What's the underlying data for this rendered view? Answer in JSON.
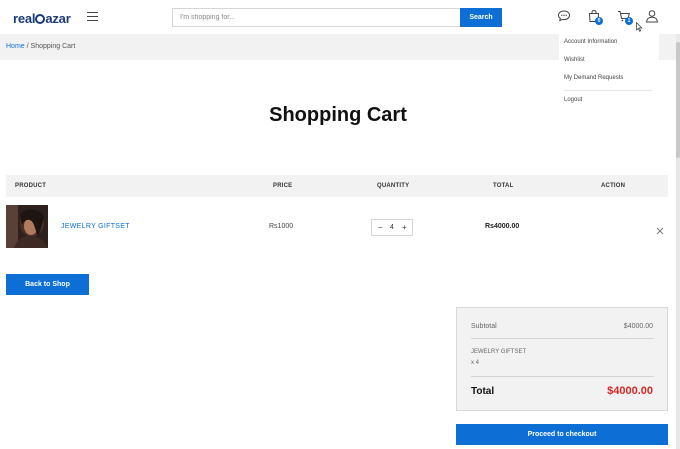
{
  "brand": {
    "name_start": "real",
    "name_end": "azar",
    "accent_color": "#0d6fd6",
    "logo_color": "#1a3a78"
  },
  "search": {
    "placeholder": "I'm shopping for...",
    "button_label": "Search"
  },
  "header": {
    "icons": [
      "menu-icon",
      "chat-icon",
      "bag-icon",
      "cart-icon",
      "user-icon"
    ],
    "bag_count": "0",
    "cart_count": "1"
  },
  "breadcrumb": {
    "home": "Home",
    "separator": "/",
    "current": "Shopping Cart"
  },
  "account_menu": {
    "items": [
      "Account Information",
      "Wishlist",
      "My Demand Requests",
      "Logout"
    ]
  },
  "page": {
    "title": "Shopping Cart"
  },
  "cart_table": {
    "headers": [
      "PRODUCT",
      "PRICE",
      "QUANTITY",
      "TOTAL",
      "ACTION"
    ],
    "rows": [
      {
        "product": "JEWELRY GIFTSET",
        "price": "Rs1000",
        "quantity": "4",
        "total": "Rs4000.00",
        "decrement": "−",
        "increment": "+",
        "remove": "×"
      }
    ]
  },
  "back_button": "Back to Shop",
  "summary": {
    "subtotal_label": "Subtotal",
    "subtotal_value": "$4000.00",
    "item_name": "JEWELRY GIFTSET",
    "item_qty": "x 4",
    "total_label": "Total",
    "total_value": "$4000.00",
    "total_color": "#d62828"
  },
  "checkout_button": "Proceed to checkout"
}
